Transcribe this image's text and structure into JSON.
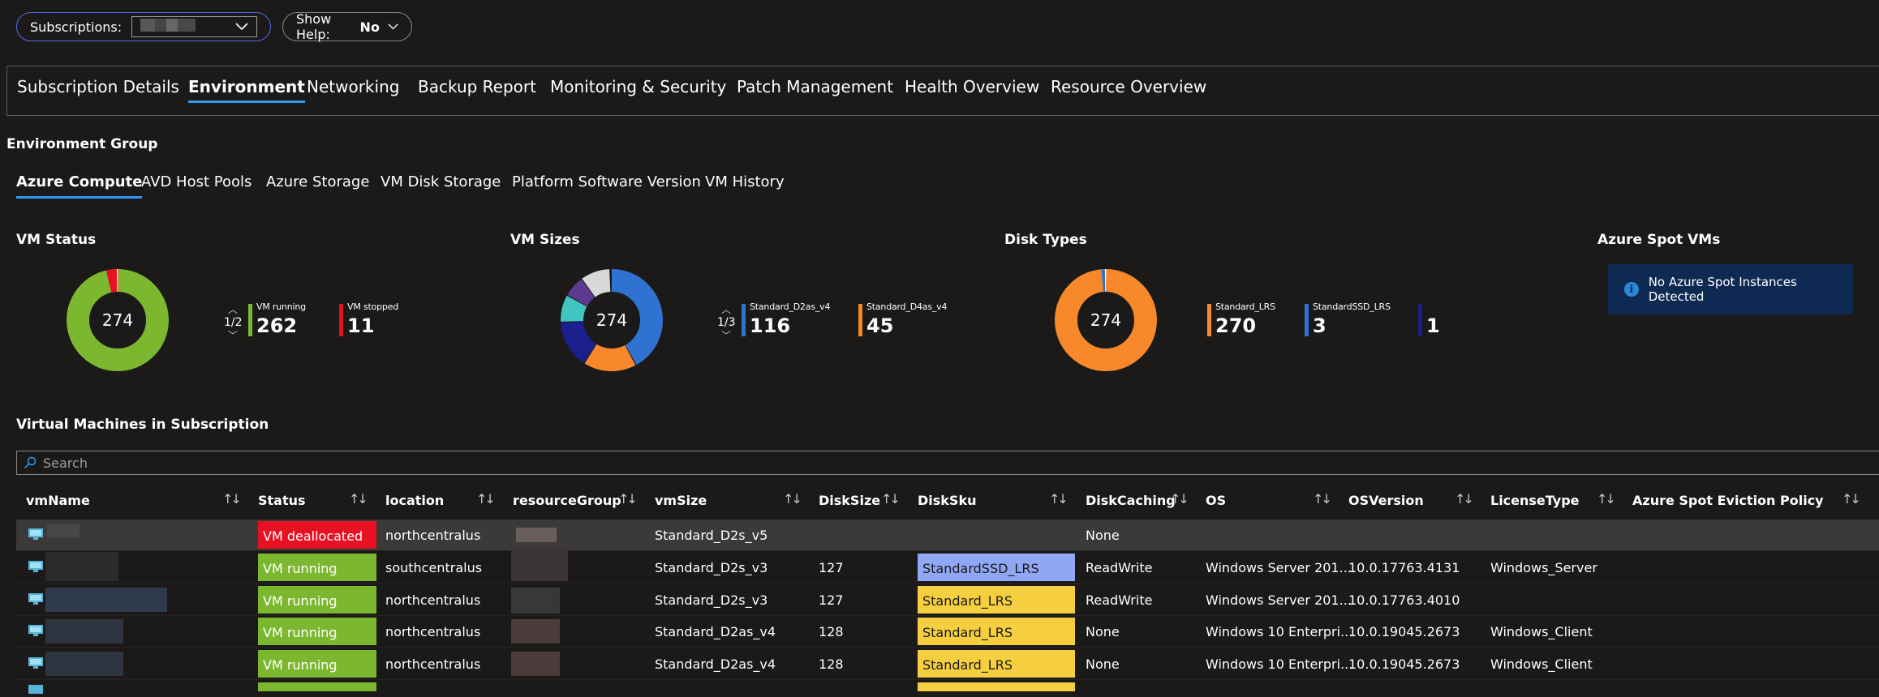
{
  "params": {
    "subscriptions_label": "Subscriptions:",
    "show_help_label": "Show Help:",
    "show_help_value": "No"
  },
  "main_tabs": [
    "Subscription Details",
    "Environment",
    "Networking",
    "Backup Report",
    "Monitoring & Security",
    "Patch Management",
    "Health Overview",
    "Resource Overview"
  ],
  "group_title": "Environment Group",
  "sub_tabs": [
    "Azure Compute",
    "AVD Host Pools",
    "Azure Storage",
    "VM Disk Storage",
    "Platform Software Version",
    "VM History"
  ],
  "tiles": {
    "vm_status": {
      "title": "VM Status",
      "total": "274",
      "pager": "1/2",
      "legend": [
        {
          "label": "VM running",
          "value": "262",
          "color": "#7cb82f"
        },
        {
          "label": "VM stopped",
          "value": "11",
          "color": "#e81123"
        }
      ]
    },
    "vm_sizes": {
      "title": "VM Sizes",
      "total": "274",
      "pager": "1/3",
      "legend": [
        {
          "label": "Standard_D2as_v4",
          "value": "116",
          "color": "#2f72d1"
        },
        {
          "label": "Standard_D4as_v4",
          "value": "45",
          "color": "#f7892c"
        }
      ]
    },
    "disk_types": {
      "title": "Disk Types",
      "total": "274",
      "legend": [
        {
          "label": "Standard_LRS",
          "value": "270",
          "color": "#f7892c"
        },
        {
          "label": "StandardSSD_LRS",
          "value": "3",
          "color": "#2f72d1"
        },
        {
          "label": "",
          "value": "1",
          "color": "#1a1f8c"
        }
      ]
    },
    "spot": {
      "title": "Azure Spot VMs",
      "message": "No Azure Spot Instances Detected"
    }
  },
  "vm_section_title": "Virtual Machines in Subscription",
  "search_placeholder": "Search",
  "columns": [
    "vmName",
    "Status",
    "location",
    "resourceGroup",
    "vmSize",
    "DiskSize",
    "DiskSku",
    "DiskCaching",
    "OS",
    "OSVersion",
    "LicenseType",
    "Azure Spot Eviction Policy"
  ],
  "rows": [
    {
      "status": "VM deallocated",
      "location": "northcentralus",
      "vmSize": "Standard_D2s_v5",
      "diskSize": "",
      "diskSku": "",
      "diskCaching": "None",
      "os": "",
      "osVersion": "",
      "license": ""
    },
    {
      "status": "VM running",
      "location": "southcentralus",
      "vmSize": "Standard_D2s_v3",
      "diskSize": "127",
      "diskSku": "StandardSSD_LRS",
      "diskCaching": "ReadWrite",
      "os": "Windows Server 201...",
      "osVersion": "10.0.17763.4131",
      "license": "Windows_Server"
    },
    {
      "status": "VM running",
      "location": "northcentralus",
      "vmSize": "Standard_D2s_v3",
      "diskSize": "127",
      "diskSku": "Standard_LRS",
      "diskCaching": "ReadWrite",
      "os": "Windows Server 201...",
      "osVersion": "10.0.17763.4010",
      "license": ""
    },
    {
      "status": "VM running",
      "location": "northcentralus",
      "vmSize": "Standard_D2as_v4",
      "diskSize": "128",
      "diskSku": "Standard_LRS",
      "diskCaching": "None",
      "os": "Windows 10 Enterpri...",
      "osVersion": "10.0.19045.2673",
      "license": "Windows_Client"
    },
    {
      "status": "VM running",
      "location": "northcentralus",
      "vmSize": "Standard_D2as_v4",
      "diskSize": "128",
      "diskSku": "Standard_LRS",
      "diskCaching": "None",
      "os": "Windows 10 Enterpri...",
      "osVersion": "10.0.19045.2673",
      "license": "Windows_Client"
    }
  ],
  "colors": {
    "running": "#7cb82f",
    "deallocated": "#e81123",
    "sku_ssd": "#8fa7f5",
    "sku_std": "#f5cf3f",
    "accent": "#2899f5"
  }
}
